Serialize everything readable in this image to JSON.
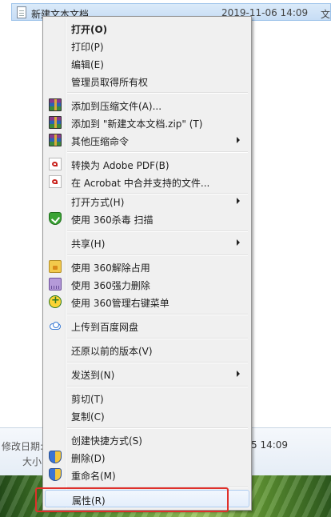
{
  "file_row": {
    "name": "新建文本文档",
    "date": "2019-11-06 14:09",
    "type": "文"
  },
  "details": {
    "modified_label": "修改日期:",
    "modified_value": "5 14:09",
    "size_label": "大小:"
  },
  "menu": {
    "items": [
      {
        "label": "打开(O)",
        "icon": null,
        "submenu": false
      },
      {
        "label": "打印(P)",
        "icon": null,
        "submenu": false
      },
      {
        "label": "编辑(E)",
        "icon": null,
        "submenu": false
      },
      {
        "label": "管理员取得所有权",
        "icon": null,
        "submenu": false
      },
      {
        "label": "添加到压缩文件(A)...",
        "icon": "winrar-icon",
        "submenu": false
      },
      {
        "label": "添加到 \"新建文本文档.zip\" (T)",
        "icon": "winrar-icon",
        "submenu": false
      },
      {
        "label": "其他压缩命令",
        "icon": "winrar-icon",
        "submenu": true
      },
      {
        "label": "转换为 Adobe PDF(B)",
        "icon": "pdf-icon",
        "submenu": false
      },
      {
        "label": "在 Acrobat 中合并支持的文件...",
        "icon": "pdf-icon",
        "submenu": false
      },
      {
        "label": "打开方式(H)",
        "icon": null,
        "submenu": true
      },
      {
        "label": "使用 360杀毒 扫描",
        "icon": "shield-icon",
        "submenu": false
      },
      {
        "label": "共享(H)",
        "icon": null,
        "submenu": true
      },
      {
        "label": "使用 360解除占用",
        "icon": "folder-lock-icon",
        "submenu": false
      },
      {
        "label": "使用 360强力删除",
        "icon": "shredder-icon",
        "submenu": false
      },
      {
        "label": "使用 360管理右键菜单",
        "icon": "360-menu-icon",
        "submenu": false
      },
      {
        "label": "上传到百度网盘",
        "icon": "cloud-icon",
        "submenu": false
      },
      {
        "label": "还原以前的版本(V)",
        "icon": null,
        "submenu": false
      },
      {
        "label": "发送到(N)",
        "icon": null,
        "submenu": true
      },
      {
        "label": "剪切(T)",
        "icon": null,
        "submenu": false
      },
      {
        "label": "复制(C)",
        "icon": null,
        "submenu": false
      },
      {
        "label": "创建快捷方式(S)",
        "icon": null,
        "submenu": false
      },
      {
        "label": "删除(D)",
        "icon": "uac-shield-icon",
        "submenu": false
      },
      {
        "label": "重命名(M)",
        "icon": "uac-shield-icon",
        "submenu": false
      },
      {
        "label": "属性(R)",
        "icon": null,
        "submenu": false
      }
    ]
  },
  "colors": {
    "highlight_box": "#e0302a",
    "menu_bg": "#f0f0f0",
    "selection_bg": "#c7ddf5"
  }
}
